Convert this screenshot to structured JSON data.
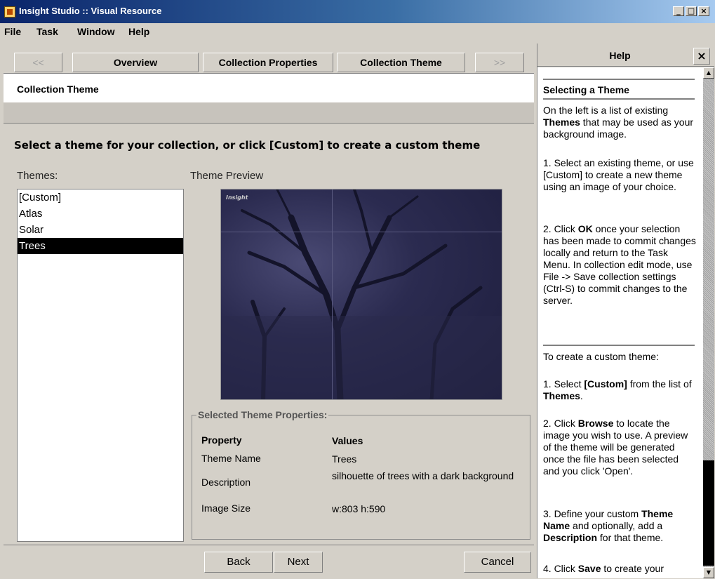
{
  "window": {
    "title": "Insight Studio :: Visual Resource"
  },
  "menu": [
    "File",
    "Task",
    "Window",
    "Help"
  ],
  "nav": {
    "prev": "<<",
    "tabs": [
      "Overview",
      "Collection Properties",
      "Collection Theme"
    ],
    "next": ">>"
  },
  "page_heading": "Collection Theme",
  "instruction": "Select a theme for your collection, or click [Custom] to create a custom theme",
  "themes_label": "Themes:",
  "themes": [
    "[Custom]",
    "Atlas",
    "Solar",
    "Trees"
  ],
  "selected_theme": "Trees",
  "preview_label": "Theme Preview",
  "preview_logo": "Insight",
  "props": {
    "legend": "Selected Theme Properties:",
    "header_property": "Property",
    "header_values": "Values",
    "rows": [
      {
        "property": "Theme Name",
        "value": "Trees"
      },
      {
        "property": "Description",
        "value": "silhouette of trees with a dark background"
      },
      {
        "property": "Image Size",
        "value": "w:803 h:590"
      }
    ]
  },
  "buttons": {
    "back": "Back",
    "next": "Next",
    "cancel": "Cancel"
  },
  "help": {
    "title": "Help",
    "section_title": "Selecting a Theme",
    "intro_a": "On the left is a list of existing ",
    "intro_b": "Themes",
    "intro_c": " that may be used as your background image.",
    "step1": "1. Select an existing theme, or use [Custom] to create a new theme using an image of your choice.",
    "step2_a": "2. Click ",
    "step2_b": "OK",
    "step2_c": " once your selection has been made to commit changes locally and return to the Task Menu. In collection edit mode, use File -> Save collection settings (Ctrl-S) to commit changes to the server.",
    "custom_title": "To create a custom theme:",
    "c1_a": "1. Select ",
    "c1_b": "[Custom]",
    "c1_c": " from the list of ",
    "c1_d": "Themes",
    "c1_e": ".",
    "c2_a": "2. Click ",
    "c2_b": "Browse",
    "c2_c": " to locate the image you wish to use. A preview of the theme will be generated once the file has been selected and you click 'Open'.",
    "c3_a": "3. Define your custom ",
    "c3_b": "Theme Name",
    "c3_c": " and optionally, add a ",
    "c3_d": "Description",
    "c3_e": " for that theme.",
    "c4_a": "4. Click ",
    "c4_b": "Save",
    "c4_c": " to create your"
  }
}
